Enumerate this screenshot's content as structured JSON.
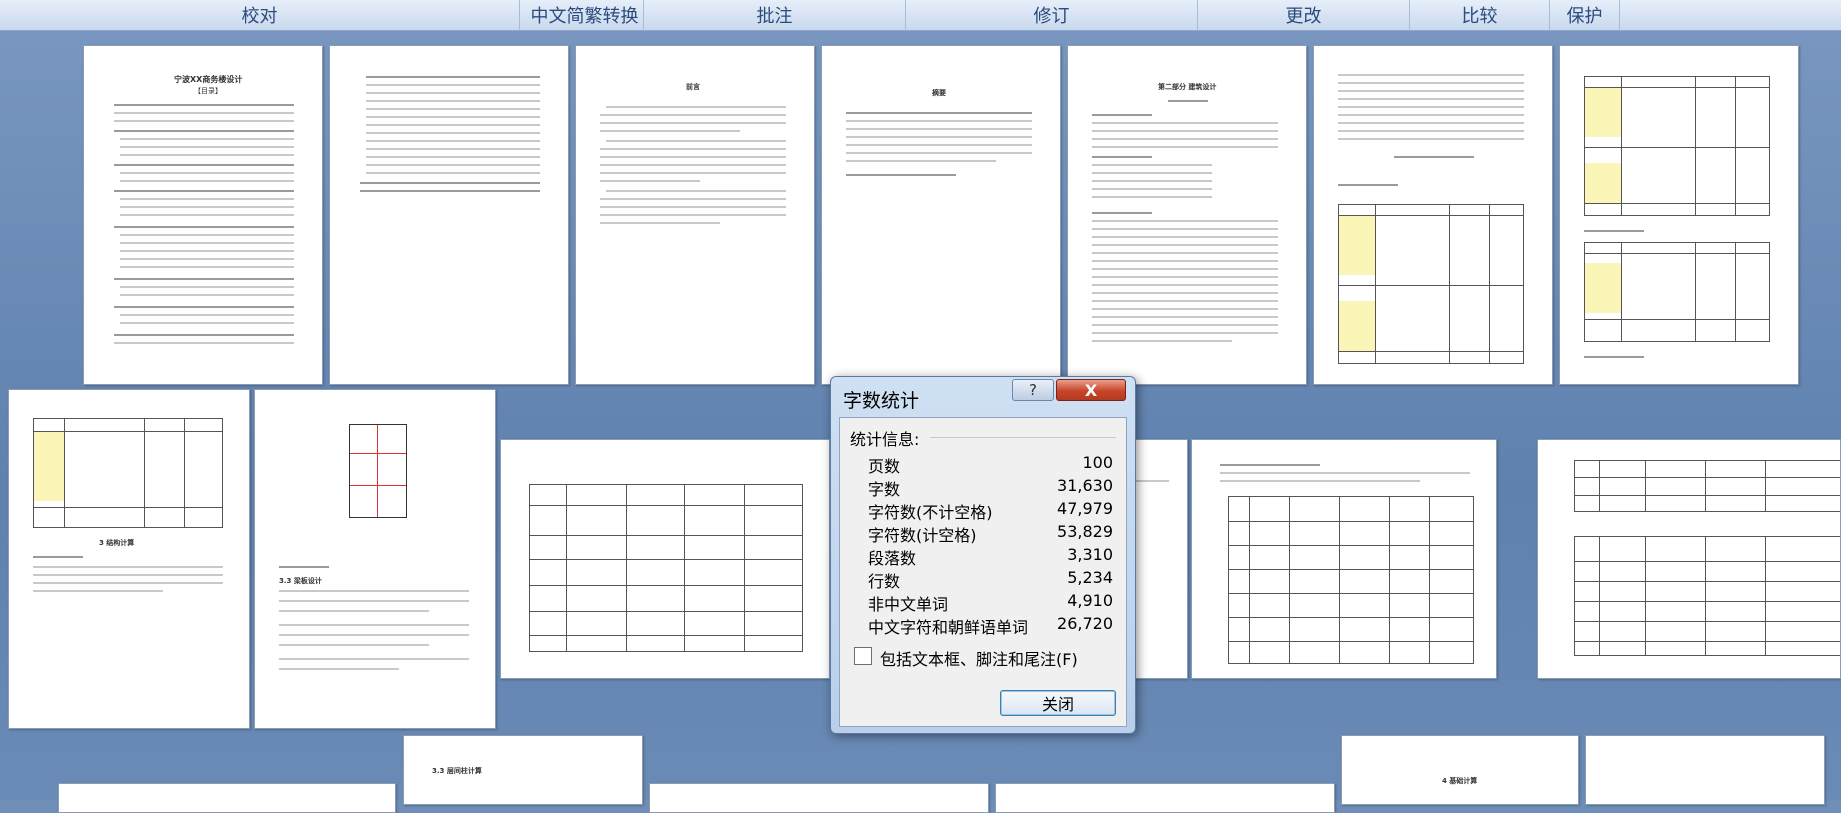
{
  "ribbon": {
    "tabs": [
      "校对",
      "中文简繁转换",
      "批注",
      "修订",
      "更改",
      "比较",
      "保护"
    ]
  },
  "pages": {
    "toc_title": "宁波XX商务楼设计",
    "toc_subtitle": "【目录】",
    "foreword_title": "前言",
    "abstract_title": "摘要",
    "part2_title": "第二部分 建筑设计",
    "calc_section": "3  结构计算",
    "grid_section": "3.3  梁板设计",
    "frame_section": "3.3  层间柱计算",
    "foundation_section": "4  基础计算"
  },
  "dialog": {
    "title": "字数统计",
    "help_label": "?",
    "close_icon_label": "X",
    "section_label": "统计信息:",
    "stats": [
      {
        "label": "页数",
        "value": "100"
      },
      {
        "label": "字数",
        "value": "31,630"
      },
      {
        "label": "字符数(不计空格)",
        "value": "47,979"
      },
      {
        "label": "字符数(计空格)",
        "value": "53,829"
      },
      {
        "label": "段落数",
        "value": "3,310"
      },
      {
        "label": "行数",
        "value": "5,234"
      },
      {
        "label": "非中文单词",
        "value": "4,910"
      },
      {
        "label": "中文字符和朝鲜语单词",
        "value": "26,720"
      }
    ],
    "checkbox_label": "包括文本框、脚注和尾注(F)",
    "checkbox_checked": false,
    "close_button_label": "关闭"
  },
  "colors": {
    "workspace": "#6f8fb8",
    "close_red": "#c8452a",
    "highlight_yellow": "#fbf6b7"
  }
}
